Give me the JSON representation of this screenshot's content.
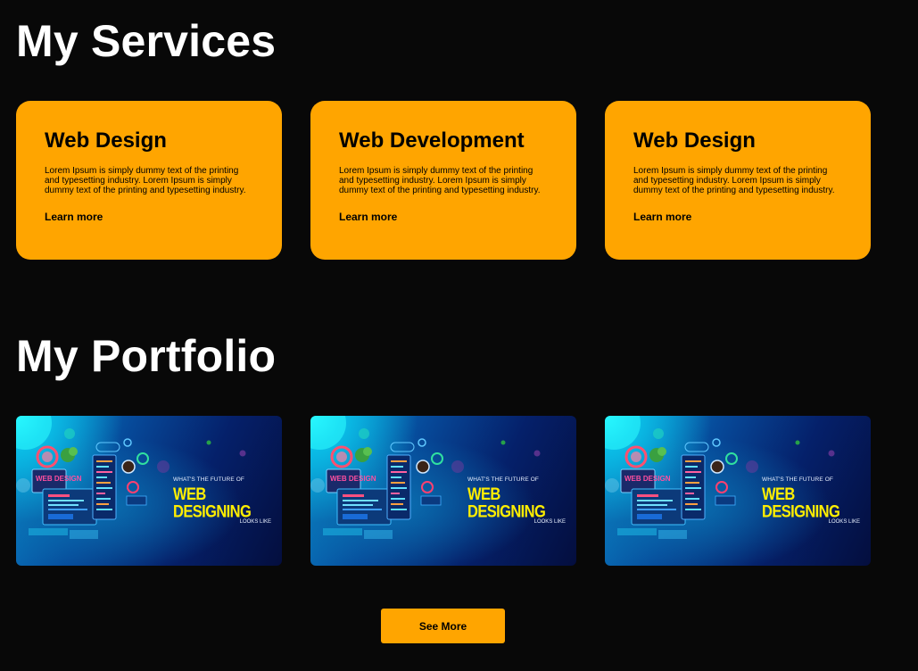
{
  "services": {
    "title": "My Services",
    "cards": [
      {
        "title": "Web Design",
        "text": "Lorem Ipsum is simply dummy text of the printing and typesetting industry. Lorem Ipsum is simply dummy text of the printing and typesetting industry.",
        "link": "Learn more"
      },
      {
        "title": "Web Development",
        "text": "Lorem Ipsum is simply dummy text of the printing and typesetting industry. Lorem Ipsum is simply dummy text of the printing and typesetting industry.",
        "link": "Learn more"
      },
      {
        "title": "Web Design",
        "text": "Lorem Ipsum is simply dummy text of the printing and typesetting industry. Lorem Ipsum is simply dummy text of the printing and typesetting industry.",
        "link": "Learn more"
      }
    ]
  },
  "portfolio": {
    "title": "My Portfolio",
    "items": [
      {
        "small": "WHAT'S THE FUTURE OF",
        "big": "WEB DESIGNING",
        "tail": "LOOKS LIKE",
        "screen": "WEB DESIGN"
      },
      {
        "small": "WHAT'S THE FUTURE OF",
        "big": "WEB DESIGNING",
        "tail": "LOOKS LIKE",
        "screen": "WEB DESIGN"
      },
      {
        "small": "WHAT'S THE FUTURE OF",
        "big": "WEB DESIGNING",
        "tail": "LOOKS LIKE",
        "screen": "WEB DESIGN"
      }
    ],
    "see_more": "See More"
  },
  "colors": {
    "background": "#080808",
    "accent": "#ffa500",
    "heading": "#ffffff",
    "banner_highlight": "#ffee00"
  }
}
